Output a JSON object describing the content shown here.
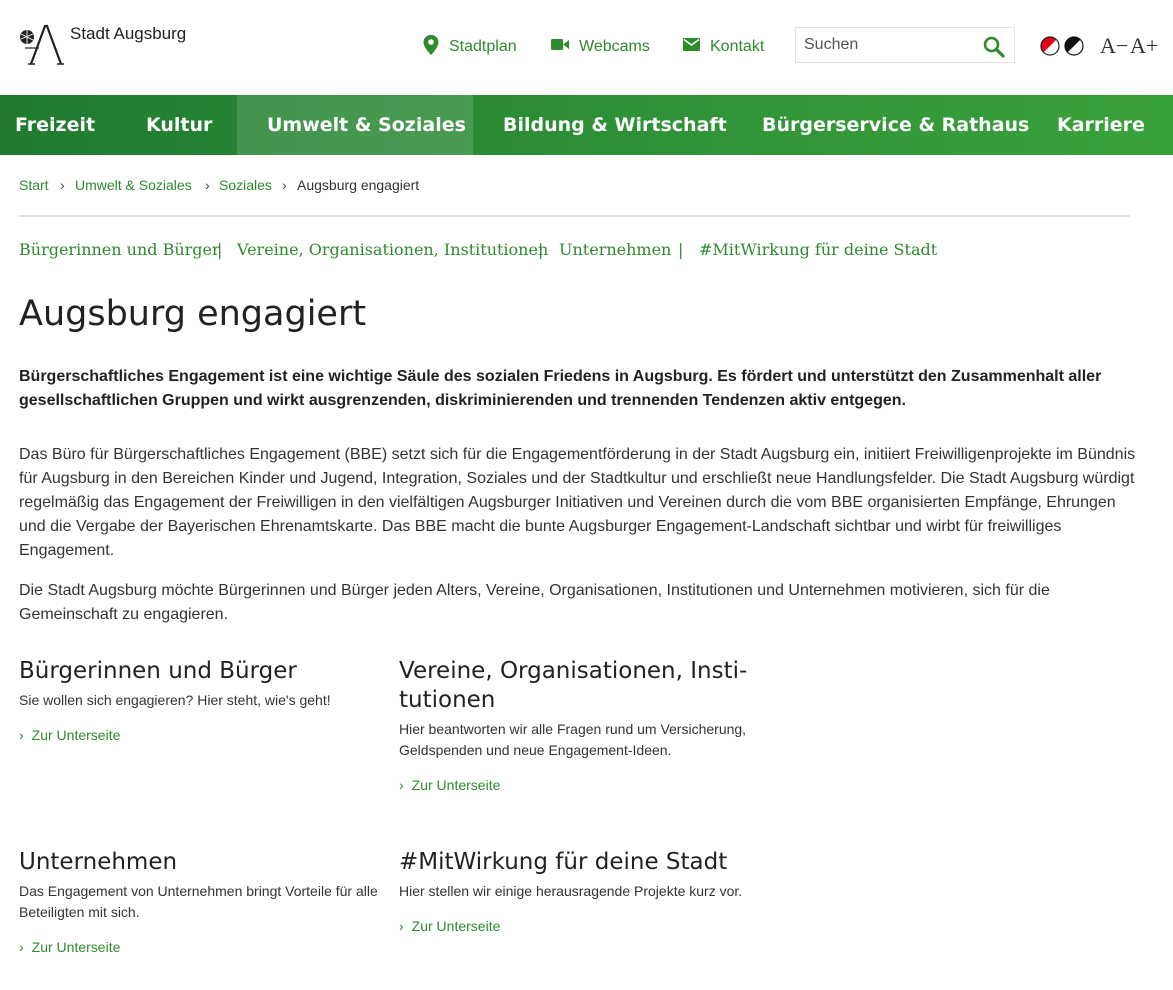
{
  "site": {
    "name": "Stadt Augsburg"
  },
  "toplinks": [
    {
      "label": "Stadtplan",
      "icon": "map-pin-icon"
    },
    {
      "label": "Webcams",
      "icon": "video-camera-icon"
    },
    {
      "label": "Kontakt",
      "icon": "envelope-icon"
    }
  ],
  "search": {
    "placeholder": "Suchen"
  },
  "accessibility": {
    "font_decrease": "A−",
    "font_increase": "A+"
  },
  "nav": [
    "Freizeit",
    "Kultur",
    "Umwelt & Soziales",
    "Bildung & Wirtschaft",
    "Bürgerservice & Rathaus",
    "Karriere"
  ],
  "breadcrumb": [
    "Start",
    "Umwelt & Soziales",
    "Soziales",
    "Augsburg engagiert"
  ],
  "breadcrumb_sep": "›",
  "subnav": [
    "Bürgerinnen und Bürger",
    "Vereine, Organisationen, Institutionen",
    "Unternehmen",
    "#MitWirkung für deine Stadt"
  ],
  "subnav_sep": "|",
  "title": "Augsburg engagiert",
  "lead": "Bürgerschaftliches Engagement ist eine wichtige Säule des sozialen Friedens in Augsburg. Es fördert und unterstützt den Zusammenhalt aller gesellschaftlichen Gruppen und wirkt ausgrenzenden, diskriminierenden und trennenden Tendenzen aktiv entgegen.",
  "paragraphs": [
    "Das Büro für Bürgerschaftliches Engagement (BBE) setzt sich für die Engagementförderung in der Stadt Augsburg ein, initiiert Freiwilligenprojekte im Bündnis für Augsburg in den Bereichen Kinder und Jugend, Integration, Soziales und der Stadtkultur und erschließt neue Handlungsfelder. Die Stadt Augsburg würdigt regelmäßig das Engagement der Freiwilligen in den vielfältigen Augsburger Initiativen und Vereinen durch die vom BBE organisierten Empfänge, Ehrungen und die Vergabe der Bayerischen Ehrenamtskarte. Das BBE macht die bunte Augsburger Engagement-Landschaft sichtbar und wirbt für freiwilliges Engagement.",
    "Die Stadt Augsburg möchte Bürgerinnen und Bürger jeden Alters, Vereine, Organisationen, Institutionen und Unternehmen motivieren, sich für die Gemeinschaft zu engagieren."
  ],
  "teasers": [
    {
      "title": "Bürgerinnen und Bürger",
      "text": "Sie wollen sich engagieren? Hier steht, wie's geht!",
      "link": "Zur Unterseite"
    },
    {
      "title": "Vereine, Organisationen, Insti­tutionen",
      "text": "Hier beantworten wir alle Fragen rund um Versicherung, Geldspenden und neue Engagement-Ideen.",
      "link": "Zur Unterseite"
    },
    {
      "title": "Unternehmen",
      "text": "Das Engagement von Unternehmen bringt Vorteile für alle Beteiligten mit sich.",
      "link": "Zur Unterseite"
    },
    {
      "title": "#MitWirkung für deine Stadt",
      "text": "Hier stellen wir einige herausragende Projekte kurz vor.",
      "link": "Zur Unterseite"
    }
  ],
  "teaser_chevron": "›",
  "colors": {
    "brand_green": "#2e8b2e",
    "nav_green_start": "#1f7a2e",
    "nav_green_end": "#3aa23c",
    "accent_red": "#e3001b"
  }
}
